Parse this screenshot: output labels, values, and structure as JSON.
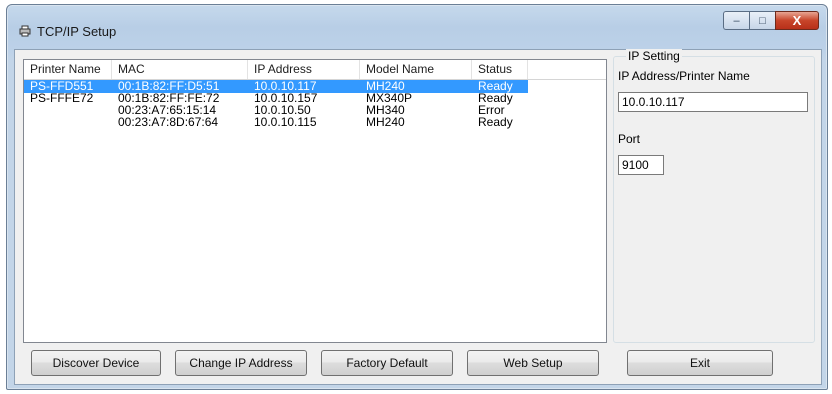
{
  "window": {
    "title": "TCP/IP Setup"
  },
  "caption_buttons": {
    "minimize": "–",
    "maximize": "□",
    "close": "X"
  },
  "table": {
    "headers": [
      "Printer Name",
      "MAC",
      "IP Address",
      "Model Name",
      "Status"
    ],
    "rows": [
      {
        "name": "PS-FFD551",
        "mac": "00:1B:82:FF:D5:51",
        "ip": "10.0.10.117",
        "model": "MH240",
        "status": "Ready",
        "selected": true
      },
      {
        "name": "PS-FFFE72",
        "mac": "00:1B:82:FF:FE:72",
        "ip": "10.0.10.157",
        "model": "MX340P",
        "status": "Ready",
        "selected": false
      },
      {
        "name": "",
        "mac": "00:23:A7:65:15:14",
        "ip": "10.0.10.50",
        "model": "MH340",
        "status": "Error",
        "selected": false
      },
      {
        "name": "",
        "mac": "00:23:A7:8D:67:64",
        "ip": "10.0.10.115",
        "model": "MH240",
        "status": "Ready",
        "selected": false
      }
    ]
  },
  "ip_setting": {
    "group_title": "IP Setting",
    "address_label": "IP Address/Printer Name",
    "address_value": "10.0.10.117",
    "port_label": "Port",
    "port_value": "9100"
  },
  "buttons": {
    "discover": "Discover Device",
    "change_ip": "Change IP Address",
    "factory_default": "Factory Default",
    "web_setup": "Web Setup",
    "exit": "Exit"
  },
  "colors": {
    "selection": "#3399ff",
    "close_button": "#c8452a"
  }
}
